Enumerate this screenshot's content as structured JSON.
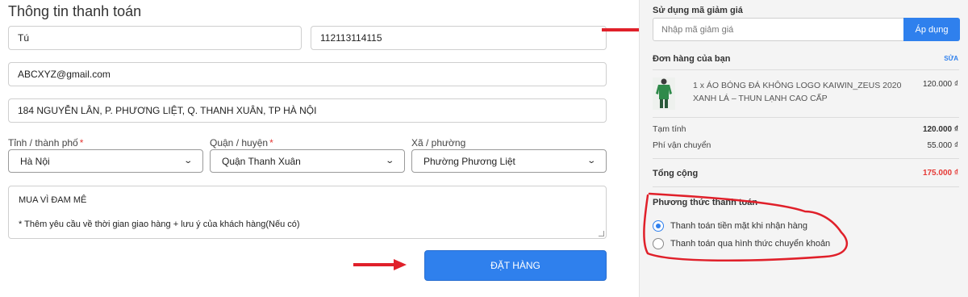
{
  "billing": {
    "title": "Thông tin thanh toán",
    "name": "Tú",
    "phone": "112113114115",
    "email": "ABCXYZ@gmail.com",
    "address": "184 NGUYỄN LÂN, P. PHƯƠNG LIỆT, Q. THANH XUÂN, TP HÀ NỘI",
    "province_label": "Tỉnh / thành phố",
    "province_value": "Hà Nội",
    "district_label": "Quận / huyện",
    "district_value": "Quận Thanh Xuân",
    "ward_label": "Xã / phường",
    "ward_value": "Phường Phương Liệt",
    "required_mark": "*",
    "note_line1": "MUA VÌ ĐAM MÊ",
    "note_line2": "* Thêm yêu cầu về thời gian giao hàng + lưu ý của khách hàng(Nếu có)",
    "order_button": "ĐẶT HÀNG"
  },
  "coupon": {
    "title": "Sử dụng mã giảm giá",
    "placeholder": "Nhập mã giảm giá",
    "apply_label": "Áp dụng"
  },
  "order": {
    "title": "Đơn hàng của bạn",
    "edit_label": "SỬA",
    "item_name": "1 x ÁO BÓNG ĐÁ KHÔNG LOGO KAIWIN_ZEUS 2020 XANH LÁ – THUN LẠNH CAO CẤP",
    "item_price": "120.000 ₫",
    "subtotal_label": "Tạm tính",
    "subtotal_value": "120.000 ₫",
    "shipping_label": "Phí vận chuyển",
    "shipping_value": "55.000 ₫",
    "total_label": "Tổng cộng",
    "total_value": "175.000 ₫"
  },
  "payment": {
    "title": "Phương thức thanh toán",
    "options": [
      {
        "label": "Thanh toán tiền mặt khi nhận hàng",
        "selected": true
      },
      {
        "label": "Thanh toán qua hình thức chuyển khoản",
        "selected": false
      }
    ]
  },
  "colors": {
    "accent": "#2f80ed",
    "annotation_red": "#e0202a",
    "total_red": "#e53935"
  },
  "icons": {
    "select_chevron": "chevron-down-icon",
    "annotation_arrow": "arrow-right-icon"
  }
}
